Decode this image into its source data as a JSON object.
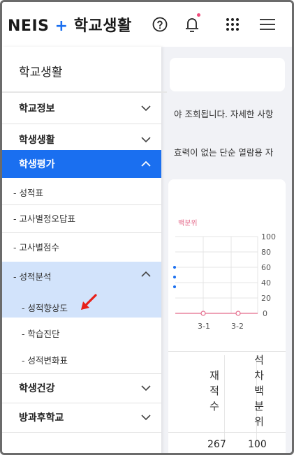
{
  "header": {
    "brand_neis": "NEIS",
    "brand_plus": "+",
    "brand_name": "학교생활",
    "icons": [
      "help-icon",
      "bell-icon",
      "grid-icon",
      "menu-icon"
    ]
  },
  "background": {
    "notice_line1": "야 조회됩니다. 자세한 사항",
    "notice_line2": "효력이 없는 단순 열람용 자",
    "legend": "백분위",
    "y_ticks": [
      "100",
      "80",
      "60",
      "40",
      "20",
      "0"
    ],
    "x_ticks": [
      "3-1",
      "3-2"
    ],
    "columns": [
      [
        "재",
        "적",
        "수"
      ],
      [
        "석",
        "차",
        "백",
        "분",
        "위"
      ]
    ],
    "values": [
      "267",
      "100"
    ]
  },
  "drawer": {
    "title": "학교생활",
    "items": [
      {
        "label": "학교정보",
        "state": "collapsed"
      },
      {
        "label": "학생생활",
        "state": "collapsed"
      },
      {
        "label": "학생평가",
        "state": "expanded"
      },
      {
        "label": "학생건강",
        "state": "collapsed"
      },
      {
        "label": "방과후학교",
        "state": "collapsed"
      }
    ],
    "sub_items": [
      "- 성적표",
      "- 고사별정오답표",
      "- 고사별점수",
      "- 성적분석"
    ],
    "subsub_items": [
      "- 성적향상도",
      "- 학습진단",
      "- 성적변화표"
    ]
  },
  "colors": {
    "accent": "#1a6ff0",
    "highlight": "#d2e3fb",
    "legend_pink": "#e46b8b",
    "arrow_red": "#e8201a"
  }
}
